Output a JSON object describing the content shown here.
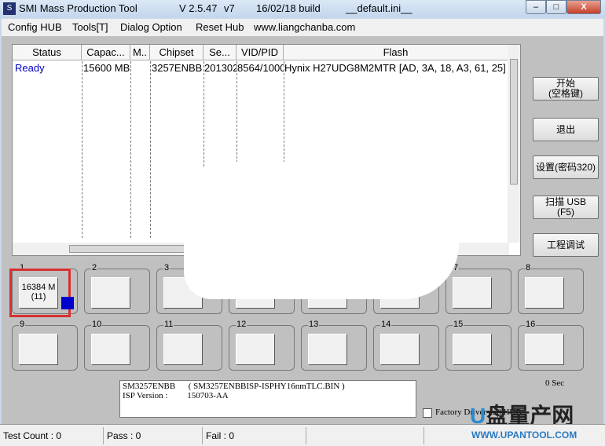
{
  "window": {
    "title": "SMI Mass Production Tool",
    "version": "V 2.5.47",
    "variant": "v7",
    "build": "16/02/18 build",
    "ini": "__default.ini__"
  },
  "menu": [
    "Config HUB",
    "Tools[T]",
    "Dialog Option",
    "Reset Hub",
    "www.liangchanba.com"
  ],
  "table": {
    "columns": [
      "Status",
      "Capac...",
      "M..",
      "Chipset",
      "Se...",
      "VID/PID",
      "Flash"
    ],
    "rows": [
      {
        "status": "Ready",
        "capacity": "15600 MB",
        "m": "",
        "chipset": "3257ENBB",
        "serial": "201302",
        "vidpid": "8564/1000",
        "flash": "Hynix H27UDG8M2MTR [AD, 3A, 18, A3, 61, 25]"
      }
    ]
  },
  "buttons": {
    "start": "开始\n(空格键)",
    "exit": "退出",
    "settings": "设置(密码320)",
    "scan": "扫描 USB\n(F5)",
    "engineering": "工程调试"
  },
  "slots": [
    {
      "n": "1",
      "text": "16384 M\n(11)",
      "active": true
    },
    {
      "n": "2"
    },
    {
      "n": "3"
    },
    {
      "n": "4"
    },
    {
      "n": "5"
    },
    {
      "n": "6"
    },
    {
      "n": "7"
    },
    {
      "n": "8"
    },
    {
      "n": "9"
    },
    {
      "n": "10"
    },
    {
      "n": "11"
    },
    {
      "n": "12"
    },
    {
      "n": "13"
    },
    {
      "n": "14"
    },
    {
      "n": "15"
    },
    {
      "n": "16"
    }
  ],
  "info": {
    "line1": "SM3257ENBB      ( SM3257ENBBISP-ISPHY16nmTLC.BIN )",
    "line2": "ISP Version :         150703-AA"
  },
  "timer": "0 Sec",
  "factory_label": "Factory Driver and HUB",
  "status": {
    "test_count": "Test Count : 0",
    "pass": "Pass : 0",
    "fail": "Fail : 0"
  },
  "watermark": {
    "brand": "U盘量产网",
    "url": "WWW.UPANTOOL.COM"
  },
  "colors": {
    "ready": "#0000c0",
    "highlight": "#e03030",
    "indicator": "#0000cc"
  }
}
